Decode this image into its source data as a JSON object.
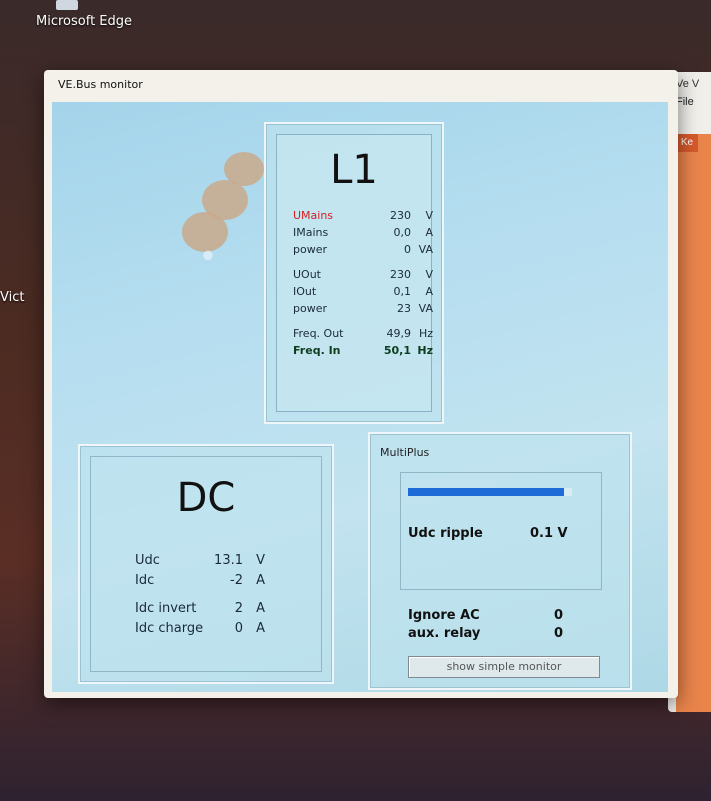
{
  "desktop": {
    "icon_label": "Microsoft Edge",
    "side_label": "Vict"
  },
  "right_window": {
    "title": "Ve V",
    "menu_file": "File",
    "tab_label": "Ke"
  },
  "window": {
    "title": "VE.Bus monitor"
  },
  "l1": {
    "title": "L1",
    "rows": [
      {
        "label": "UMains",
        "value": "230",
        "unit": "V",
        "style": "red"
      },
      {
        "label": "IMains",
        "value": "0,0",
        "unit": "A",
        "style": ""
      },
      {
        "label": "power",
        "value": "0",
        "unit": "VA",
        "style": ""
      },
      {
        "label": "UOut",
        "value": "230",
        "unit": "V",
        "style": ""
      },
      {
        "label": "IOut",
        "value": "0,1",
        "unit": "A",
        "style": ""
      },
      {
        "label": "power",
        "value": "23",
        "unit": "VA",
        "style": ""
      },
      {
        "label": "Freq. Out",
        "value": "49,9",
        "unit": "Hz",
        "style": ""
      },
      {
        "label": "Freq. In",
        "value": "50,1",
        "unit": "Hz",
        "style": "bold"
      }
    ]
  },
  "dc": {
    "title": "DC",
    "rows": [
      {
        "label": "Udc",
        "value": "13.1",
        "unit": "V"
      },
      {
        "label": "Idc",
        "value": "-2",
        "unit": "A"
      },
      {
        "label": "Idc invert",
        "value": "2",
        "unit": "A"
      },
      {
        "label": "Idc charge",
        "value": "0",
        "unit": "A"
      }
    ]
  },
  "multiplus": {
    "legend": "MultiPlus",
    "progress_fraction": 0.95,
    "progress_color": "#1c6bd6",
    "udc_ripple_label": "Udc ripple",
    "udc_ripple_value": "0.1 V",
    "ignore_ac_label": "Ignore AC",
    "ignore_ac_value": "0",
    "aux_relay_label": "aux. relay",
    "aux_relay_value": "0",
    "show_simple_monitor_label": "show simple monitor"
  }
}
